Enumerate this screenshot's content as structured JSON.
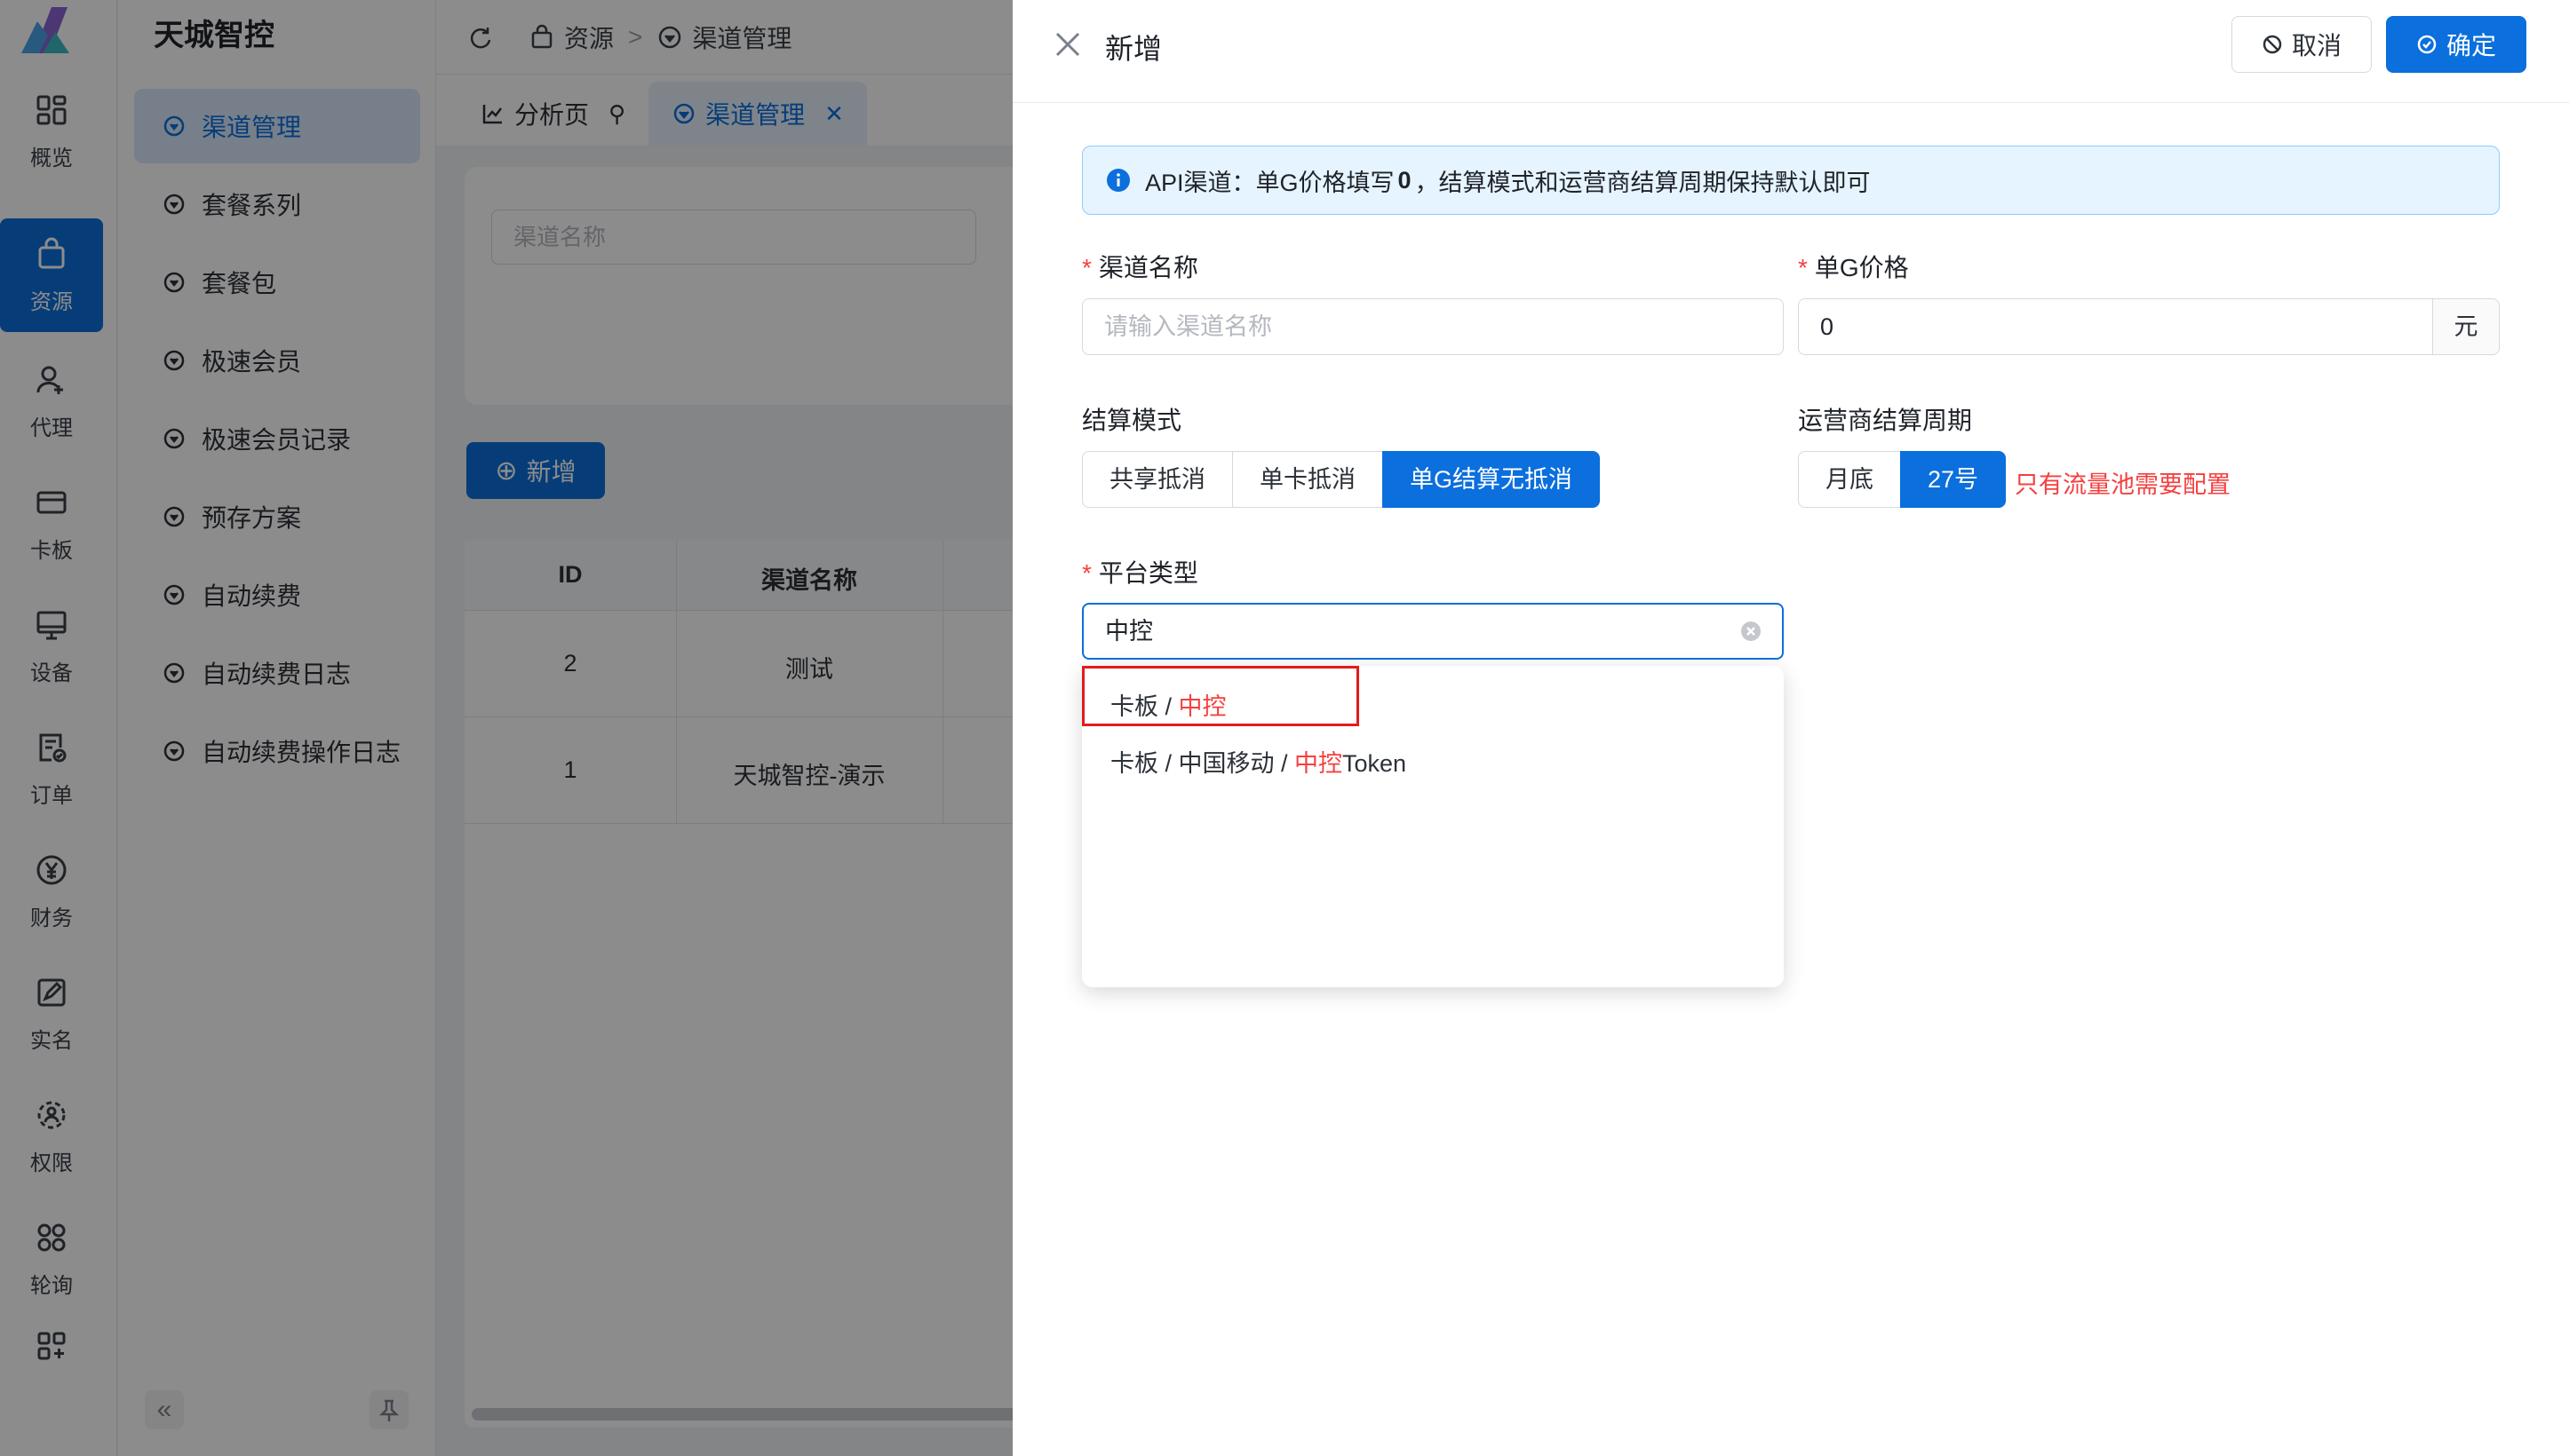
{
  "app": {
    "brand": "天城智控"
  },
  "rail": {
    "items": [
      {
        "label": "概览",
        "icon": "dashboard-icon"
      },
      {
        "label": "资源",
        "icon": "bag-icon",
        "active": true
      },
      {
        "label": "代理",
        "icon": "agent-icon"
      },
      {
        "label": "卡板",
        "icon": "card-icon"
      },
      {
        "label": "设备",
        "icon": "device-icon"
      },
      {
        "label": "订单",
        "icon": "order-icon"
      },
      {
        "label": "财务",
        "icon": "yen-icon"
      },
      {
        "label": "实名",
        "icon": "realname-icon"
      },
      {
        "label": "权限",
        "icon": "permission-icon"
      },
      {
        "label": "轮询",
        "icon": "poll-icon"
      }
    ]
  },
  "menu": {
    "items": [
      {
        "label": "渠道管理",
        "active": true
      },
      {
        "label": "套餐系列"
      },
      {
        "label": "套餐包"
      },
      {
        "label": "极速会员"
      },
      {
        "label": "极速会员记录"
      },
      {
        "label": "预存方案"
      },
      {
        "label": "自动续费"
      },
      {
        "label": "自动续费日志"
      },
      {
        "label": "自动续费操作日志"
      }
    ],
    "collapse": "«"
  },
  "breadcrumb": {
    "root": "资源",
    "sep": ">",
    "current": "渠道管理"
  },
  "tabs": [
    {
      "label": "分析页",
      "pin": "⚲"
    },
    {
      "label": "渠道管理",
      "close": "✕",
      "active": true
    }
  ],
  "search": {
    "channel_placeholder": "渠道名称"
  },
  "add_button": "新增",
  "table": {
    "headers": [
      "ID",
      "渠道名称"
    ],
    "rows": [
      {
        "id": "2",
        "name": "测试"
      },
      {
        "id": "1",
        "name": "天城智控-演示"
      }
    ]
  },
  "drawer": {
    "title": "新增",
    "cancel": "取消",
    "confirm": "确定",
    "alert": {
      "prefix": "API渠道：单G价格填写",
      "bold": "0",
      "suffix": "，结算模式和运营商结算周期保持默认即可"
    },
    "fields": {
      "channel_name": {
        "label": "渠道名称",
        "placeholder": "请输入渠道名称",
        "required": "*"
      },
      "unit_price": {
        "label": "单G价格",
        "value": "0",
        "suffix": "元",
        "required": "*"
      },
      "settle_mode": {
        "label": "结算模式",
        "options": [
          "共享抵消",
          "单卡抵消",
          "单G结算无抵消"
        ],
        "selected": "单G结算无抵消"
      },
      "carrier_cycle": {
        "label": "运营商结算周期",
        "options": [
          "月底",
          "27号"
        ],
        "selected": "27号",
        "hint": "只有流量池需要配置"
      },
      "platform_type": {
        "label": "平台类型",
        "value": "中控",
        "required": "*"
      }
    },
    "dropdown": {
      "options": [
        {
          "prefix": "卡板 / ",
          "match": "中控",
          "suffix": ""
        },
        {
          "prefix": "卡板 / 中国移动 / ",
          "match": "中控",
          "suffix": "Token"
        }
      ]
    }
  },
  "colors": {
    "primary": "#0b6fdd",
    "danger": "#f53f3f",
    "highlight_box": "#e31b1b"
  }
}
